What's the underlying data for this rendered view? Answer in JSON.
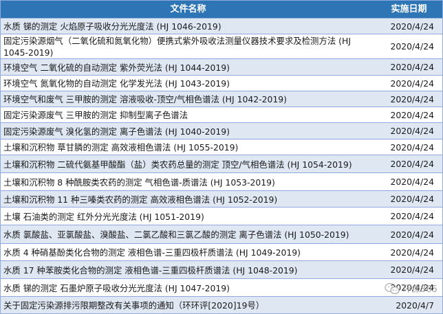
{
  "header": {
    "name_col": "文件名称",
    "date_col": "实施日期"
  },
  "rows": [
    {
      "name": "水质 锑的测定 火焰原子吸收分光光度法 (HJ 1046-2019)",
      "date": "2020/4/24"
    },
    {
      "name": "固定污染源烟气（二氧化硫和氮氧化物）便携式紫外吸收法测量仪器技术要求及检测方法 (HJ 1045-2019)",
      "date": "2020/4/24"
    },
    {
      "name": "环境空气 二氧化硫的自动测定 紫外荧光法 (HJ 1044-2019)",
      "date": "2020/4/24"
    },
    {
      "name": "环境空气 氮氧化物的自动测定 化学发光法 (HJ 1043-2019)",
      "date": "2020/4/24"
    },
    {
      "name": "环境空气和废气 三甲胺的测定 溶液吸收-顶空/气相色谱法 (HJ 1042-2019)",
      "date": "2020/4/24"
    },
    {
      "name": "固定污染源废气 三甲胺的测定 抑制型离子色谱法",
      "date": "2020/4/24"
    },
    {
      "name": "固定污染源废气 溴化氢的测定 离子色谱法 (HJ 1040-2019)",
      "date": "2020/4/24"
    },
    {
      "name": "土壤和沉积物 草甘膦的测定 高效液相色谱法 (HJ 1055-2019)",
      "date": "2020/4/24"
    },
    {
      "name": "土壤和沉积物 二硫代氨基甲酸酯（盐）类农药总量的测定 顶空/气相色谱法 (HJ 1054-2019)",
      "date": "2020/4/24"
    },
    {
      "name": "土壤和沉积物 8 种酰胺类农药的测定 气相色谱-质谱法 (HJ 1053-2019)",
      "date": "2020/4/24"
    },
    {
      "name": "土壤和沉积物 11 种三嗪类农药的测定 高效液相色谱法 (HJ 1052-2019)",
      "date": "2020/4/24"
    },
    {
      "name": "土壤 石油类的测定 红外分光光度法 (HJ 1051-2019)",
      "date": "2020/4/24"
    },
    {
      "name": "水质 氯酸盐、亚氯酸盐、溴酸盐、二氯乙酸和三氯乙酸的测定 离子色谱法 (HJ 1050-2019)",
      "date": "2020/4/24"
    },
    {
      "name": "水质 4 种硝基酚类化合物的测定 液相色谱-三重四极杆质谱法 (HJ 1049-2019)",
      "date": "2020/4/24"
    },
    {
      "name": "水质 17 种苯胺类化合物的测定 液相色谱-三重四极杆质谱法 (HJ 1048-2019)",
      "date": "2020/4/24"
    },
    {
      "name": "水质 锑的测定 石墨炉原子吸收分光光度法 (HJ 1047-2019)",
      "date": "2020/4/24"
    },
    {
      "name": "关于固定污染源排污限期整改有关事项的通知（环环评[2020]19号）",
      "date": "2020/4/7"
    }
  ],
  "watermark": {
    "text": "环保365",
    "icon": "wechat-icon"
  }
}
